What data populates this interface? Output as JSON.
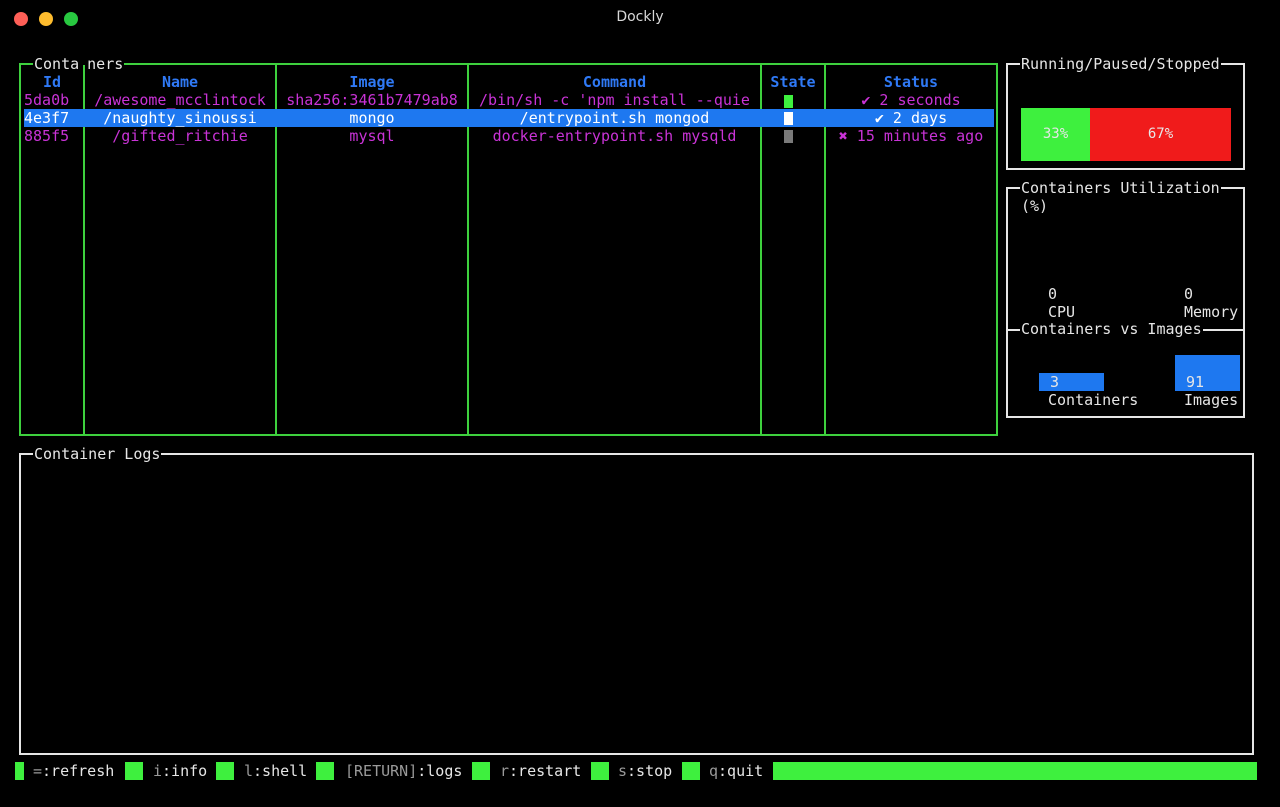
{
  "window": {
    "title": "Dockly"
  },
  "containers": {
    "title_left": "Conta",
    "title_right": "ners",
    "headers": [
      "Id",
      "Name",
      "Image",
      "Command",
      "State",
      "Status"
    ],
    "rows": [
      {
        "id": "5da0b",
        "name": "/awesome_mcclintock",
        "image": "sha256:3461b7479ab8",
        "command": "/bin/sh -c 'npm install --quie",
        "state": "running",
        "status": "✔ 2 seconds"
      },
      {
        "id": "4e3f7",
        "name": "/naughty_sinoussi",
        "image": "mongo",
        "command": "/entrypoint.sh mongod",
        "state": "running",
        "status": "✔ 2 days"
      },
      {
        "id": "885f5",
        "name": "/gifted_ritchie",
        "image": "mysql",
        "command": "docker-entrypoint.sh mysqld",
        "state": "stopped",
        "status": "✖ 15 minutes ago"
      }
    ],
    "selected_index": 1
  },
  "rps": {
    "title": "Running/Paused/Stopped",
    "running_label": "33%",
    "stopped_label": "67%",
    "running_fraction": 0.33,
    "stopped_fraction": 0.67
  },
  "utilization": {
    "title": "Containers Utilization",
    "unit": "(%)",
    "cpu_value": "0",
    "cpu_label": "CPU",
    "memory_value": "0",
    "memory_label": "Memory"
  },
  "vs": {
    "title": "Containers vs Images",
    "containers_value": "3",
    "containers_label": "Containers",
    "images_value": "91",
    "images_label": "Images"
  },
  "logs": {
    "title": "Container Logs"
  },
  "footer": {
    "keys": [
      {
        "key": "=",
        "action": ":refresh"
      },
      {
        "key": "i",
        "action": ":info"
      },
      {
        "key": "l",
        "action": ":shell"
      },
      {
        "key": "[RETURN]",
        "action": ":logs"
      },
      {
        "key": "r",
        "action": ":restart"
      },
      {
        "key": "s",
        "action": ":stop"
      },
      {
        "key": "q",
        "action": ":quit"
      }
    ]
  },
  "colors": {
    "border_green": "#3ed13e",
    "header_blue": "#2f79f5",
    "row_magenta": "#c933d6",
    "selection": "#1e78f0",
    "running": "#3ef03e",
    "stopped": "#f01b1b",
    "stopped_state": "#7a7a7a"
  }
}
